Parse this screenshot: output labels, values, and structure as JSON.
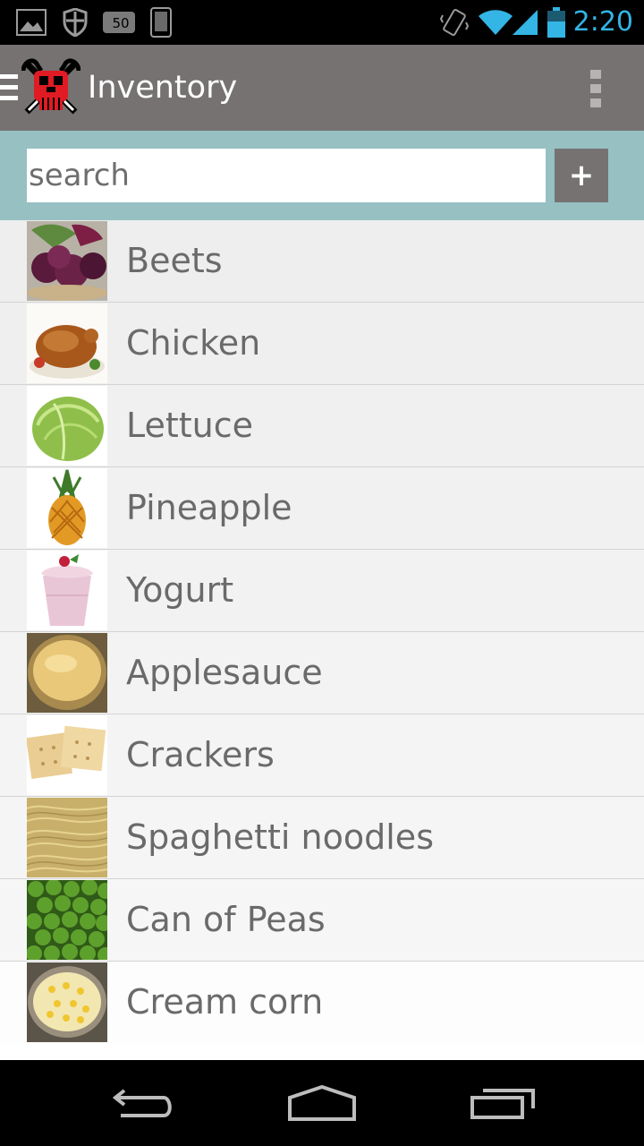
{
  "status_bar": {
    "time": "2:20",
    "icons": [
      "picture-icon",
      "shield-icon",
      "badge-50-icon",
      "phone-icon",
      "vibrate-icon",
      "wifi-icon",
      "signal-icon",
      "battery-icon"
    ],
    "badge_text": "50",
    "accent": "#33b5e5"
  },
  "action_bar": {
    "title": "Inventory",
    "color": "#767272",
    "icons": [
      "drawer-icon",
      "app-logo-icon",
      "overflow-menu-icon"
    ]
  },
  "search": {
    "placeholder": "search",
    "value": "",
    "add_label": "+",
    "bar_color": "#97c0c3"
  },
  "items": [
    {
      "label": "Beets",
      "image": "beets"
    },
    {
      "label": "Chicken",
      "image": "chicken"
    },
    {
      "label": "Lettuce",
      "image": "lettuce"
    },
    {
      "label": "Pineapple",
      "image": "pineapple"
    },
    {
      "label": "Yogurt",
      "image": "yogurt"
    },
    {
      "label": "Applesauce",
      "image": "applesauce"
    },
    {
      "label": "Crackers",
      "image": "crackers"
    },
    {
      "label": "Spaghetti noodles",
      "image": "spaghetti"
    },
    {
      "label": "Can of Peas",
      "image": "peas"
    },
    {
      "label": "Cream corn",
      "image": "cream-corn"
    }
  ],
  "nav_bar": {
    "icons": [
      "back-icon",
      "home-icon",
      "recent-apps-icon"
    ]
  }
}
